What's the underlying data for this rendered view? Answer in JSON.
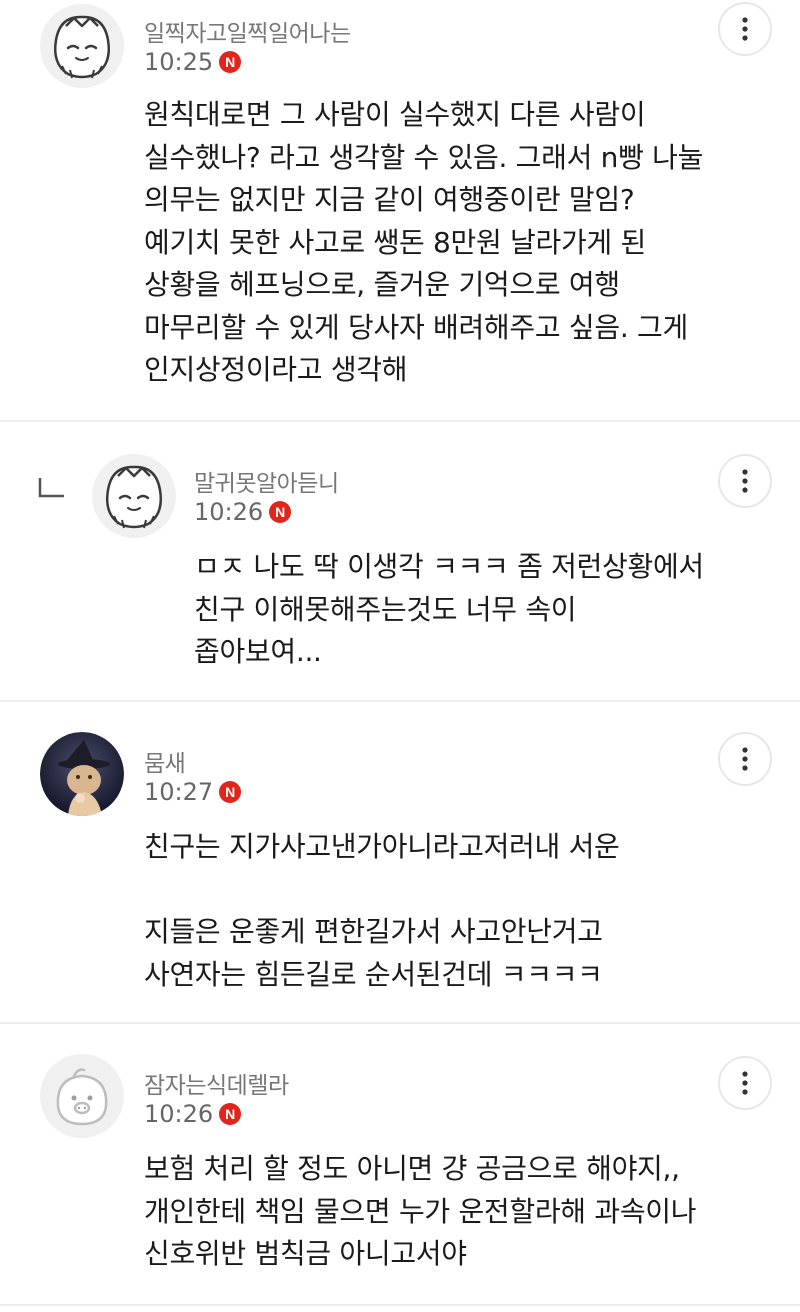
{
  "comments": [
    {
      "nickname": "일찍자고일찍일어나는",
      "time": "10:25",
      "badge": "N",
      "avatar_icon": "cute-character-avatar-icon",
      "lines": [
        "원칙대로면 그 사람이 실수했지 다른 사람이",
        "실수했나? 라고 생각할 수 있음. 그래서 n빵 나눌",
        "의무는 없지만 지금 같이 여행중이란 말임?",
        "예기치 못한 사고로 쌩돈 8만원 날라가게 된",
        "상황을 헤프닝으로, 즐거운 기억으로 여행",
        "마무리할 수 있게 당사자 배려해주고 싶음. 그게",
        "인지상정이라고 생각해"
      ]
    },
    {
      "is_reply": true,
      "nickname": "말귀못알아듣니",
      "time": "10:26",
      "badge": "N",
      "avatar_icon": "cute-character-avatar-icon",
      "lines": [
        "ㅁㅈ 나도 딱 이생각 ㅋㅋㅋ 좀 저런상황에서",
        "친구 이해못해주는것도 너무 속이",
        "좁아보여..."
      ]
    },
    {
      "nickname": "뭄새",
      "time": "10:27",
      "badge": "N",
      "avatar_icon": "photo-avatar-icon",
      "lines": [
        "친구는 지가사고낸가아니라고저러내 서운",
        "",
        "지들은 운좋게 편한길가서 사고안난거고",
        "사연자는 힘든길로 순서된건데 ㅋㅋㅋㅋ"
      ]
    },
    {
      "nickname": "잠자는식데렐라",
      "time": "10:26",
      "badge": "N",
      "avatar_icon": "default-character-avatar-icon",
      "lines": [
        "보험 처리 할 정도 아니면 걍 공금으로 해야지,,",
        "개인한테 책임 물으면 누가 운전할라해 과속이나",
        "신호위반 범칙금 아니고서야"
      ]
    }
  ],
  "icons": {
    "more": "more-vertical-icon",
    "reply": "reply-arrow-icon",
    "new_badge": "new-badge-icon"
  },
  "colors": {
    "badge": "#e1251b",
    "nickname": "#777777",
    "divider": "#ececec"
  }
}
